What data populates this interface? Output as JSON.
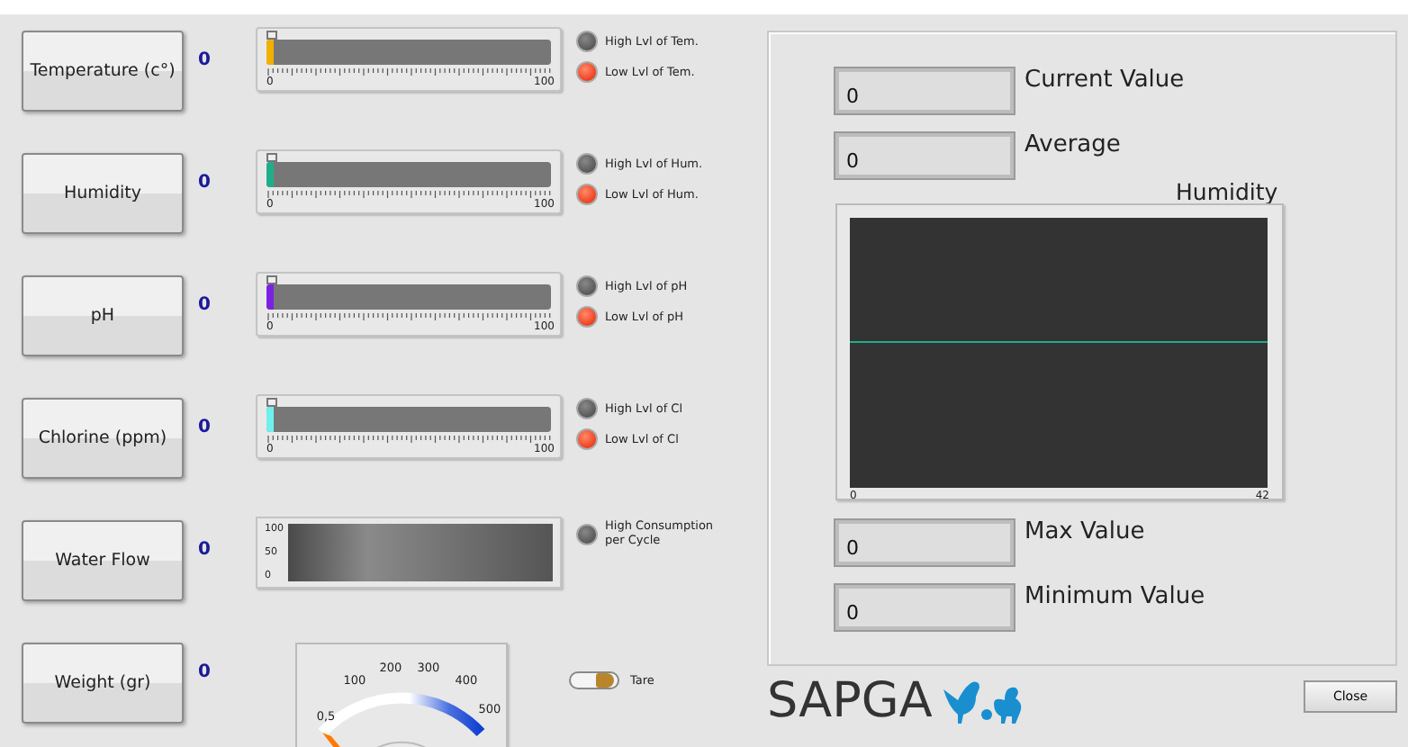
{
  "sensors": [
    {
      "kind": "slider",
      "label": "Temperature (c°)",
      "value": "0",
      "level": 0,
      "color": "#f2b000",
      "scale_min": "0",
      "scale_max": "100",
      "leds": [
        {
          "label": "High Lvl of  Tem.",
          "on": false
        },
        {
          "label": "Low Lvl of  Tem.",
          "on": true
        }
      ]
    },
    {
      "kind": "slider",
      "label": "Humidity",
      "value": "0",
      "level": 0,
      "color": "#1fae8a",
      "scale_min": "0",
      "scale_max": "100",
      "leds": [
        {
          "label": "High Lvl of  Hum.",
          "on": false
        },
        {
          "label": "Low Lvl of  Hum.",
          "on": true
        }
      ]
    },
    {
      "kind": "slider",
      "label": "pH",
      "value": "0",
      "level": 0,
      "color": "#7a22e0",
      "scale_min": "0",
      "scale_max": "100",
      "leds": [
        {
          "label": "High Lvl of  pH",
          "on": false
        },
        {
          "label": "Low Lvl of  pH",
          "on": true
        }
      ]
    },
    {
      "kind": "slider",
      "label": "Chlorine (ppm)",
      "value": "0",
      "level": 0,
      "color": "#6ff0ee",
      "scale_min": "0",
      "scale_max": "100",
      "leds": [
        {
          "label": "High Lvl of Cl",
          "on": false
        },
        {
          "label": "Low Lvl of Cl",
          "on": true
        }
      ]
    },
    {
      "kind": "flow",
      "label": "Water Flow",
      "value": "0",
      "scale": [
        "100",
        "50",
        "0"
      ],
      "leds": [
        {
          "label": "High Consumption per Cycle",
          "on": false
        }
      ]
    },
    {
      "kind": "gauge",
      "label": "Weight (gr)",
      "value": "0",
      "ticks": [
        "0,5",
        "100",
        "200",
        "300",
        "400",
        "500"
      ],
      "toggle": {
        "label": "Tare",
        "on": true
      }
    }
  ],
  "stats_top": [
    {
      "value": "0",
      "label": "Current Value"
    },
    {
      "value": "0",
      "label": "Average"
    }
  ],
  "chart": {
    "title": "Humidity",
    "x_min": "0",
    "x_max": "42"
  },
  "stats_bottom": [
    {
      "value": "0",
      "label": "Max Value"
    },
    {
      "value": "0",
      "label": "Minimum Value"
    }
  ],
  "logo": "SAPGA",
  "buttons": [
    "Close"
  ]
}
